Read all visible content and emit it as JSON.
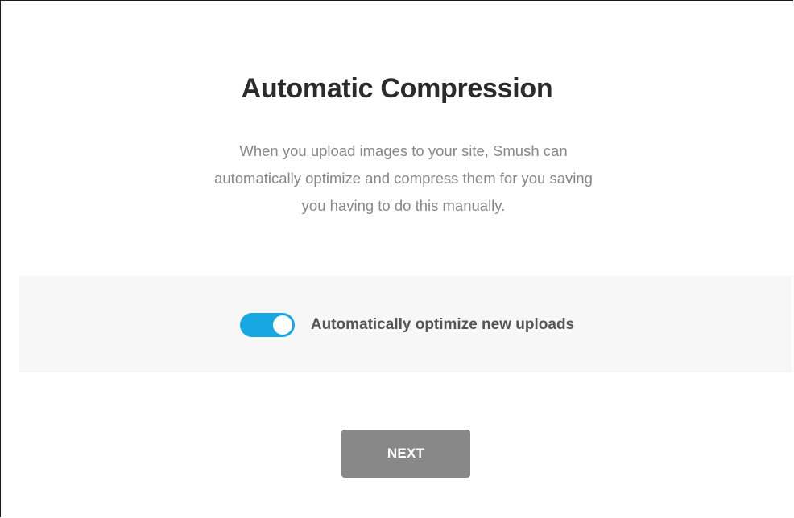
{
  "dialog": {
    "title": "Automatic Compression",
    "description_lines": [
      "When you upload images to your site, Smush can",
      "automatically optimize and compress them for you saving",
      "you having to do this manually."
    ]
  },
  "option": {
    "toggle_state": "on",
    "label": "Automatically optimize new uploads"
  },
  "actions": {
    "next_label": "NEXT"
  },
  "colors": {
    "accent": "#17a8e3",
    "button_bg": "#888888",
    "band_bg": "#f7f7f7",
    "title": "#2b2b2b",
    "description": "#888888"
  }
}
